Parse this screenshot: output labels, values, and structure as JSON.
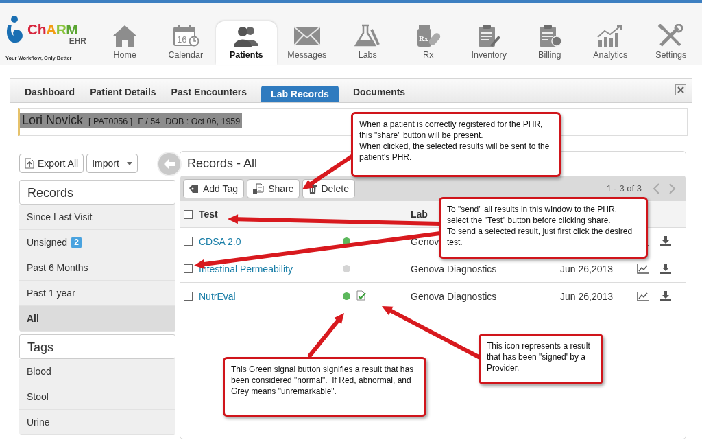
{
  "logo": {
    "name": "ChARM",
    "suffix": "EHR",
    "tagline": "Your Workflow, Only Better"
  },
  "nav": [
    {
      "label": "Home",
      "kind": "home",
      "selected": false
    },
    {
      "label": "Calendar",
      "kind": "calendar",
      "icon_text": "16",
      "selected": false
    },
    {
      "label": "Patients",
      "kind": "patients",
      "selected": true
    },
    {
      "label": "Messages",
      "kind": "messages",
      "selected": false
    },
    {
      "label": "Labs",
      "kind": "labs",
      "selected": false
    },
    {
      "label": "Rx",
      "kind": "rx",
      "icon_text": "Rx",
      "selected": false
    },
    {
      "label": "Inventory",
      "kind": "inventory",
      "selected": false
    },
    {
      "label": "Billing",
      "kind": "billing",
      "selected": false
    },
    {
      "label": "Analytics",
      "kind": "analytics",
      "selected": false
    },
    {
      "label": "Settings",
      "kind": "settings",
      "selected": false
    }
  ],
  "subtabs": [
    {
      "label": "Dashboard",
      "selected": false
    },
    {
      "label": "Patient Details",
      "selected": false
    },
    {
      "label": "Past Encounters",
      "selected": false
    },
    {
      "label": "Lab Records",
      "selected": true
    },
    {
      "label": "Documents",
      "selected": false
    }
  ],
  "patient": {
    "name": "Lori Novick",
    "id": "[ PAT0056 ]",
    "sex_age": "F / 54",
    "dob": "DOB : Oct 06, 1959"
  },
  "sidebar": {
    "buttons": [
      {
        "label": "Export All",
        "kind": "export"
      },
      {
        "label": "Import",
        "kind": "dropdown"
      }
    ],
    "sections": [
      {
        "title": "Records",
        "items": [
          {
            "label": "Since Last Visit",
            "selected": false
          },
          {
            "label": "Unsigned",
            "badge": "2",
            "selected": false
          },
          {
            "label": "Past 6 Months",
            "selected": false
          },
          {
            "label": "Past 1 year",
            "selected": false
          },
          {
            "label": "All",
            "selected": true
          }
        ]
      },
      {
        "title": "Tags",
        "items": [
          {
            "label": "Blood",
            "selected": false
          },
          {
            "label": "Stool",
            "selected": false
          },
          {
            "label": "Urine",
            "selected": false
          }
        ]
      }
    ]
  },
  "records": {
    "title": "Records - All",
    "toolbar": [
      {
        "label": "Add Tag",
        "kind": "tag"
      },
      {
        "label": "Share",
        "kind": "share"
      },
      {
        "label": "Delete",
        "kind": "trash"
      }
    ],
    "pager": "1 - 3 of 3",
    "select_all": {
      "checked": false
    },
    "columns": [
      "Test",
      "Lab"
    ],
    "rows": [
      {
        "test": "CDSA 2.0",
        "color": "#5cb85c",
        "signed": false,
        "lab": "Genov",
        "checked": false
      },
      {
        "test": "Intestinal Permeability",
        "color": "#d4d4d4",
        "signed": false,
        "lab": "Genova Diagnostics",
        "date": "Jun 26,2013",
        "checked": false
      },
      {
        "test": "NutrEval",
        "color": "#5cb85c",
        "signed": true,
        "lab": "Genova Diagnostics",
        "date": "Jun 26,2013",
        "checked": false
      }
    ]
  },
  "callouts": [
    {
      "text": "When a patient is correctly registered for the PHR, this \"share\" button will be present.\nWhen clicked, the selected results will be sent to the patient's PHR."
    },
    {
      "text": "To \"send\" all results in this window to the PHR, select the \"Test\" button before clicking share.\nTo send a selected result, just first click the desired test."
    },
    {
      "text": "This Green signal button signifies a result that has been considered \"normal\".  If Red, abnormal, and Grey means \"unremarkable\"."
    },
    {
      "text": "This icon represents a result that has been \"signed' by a Provider."
    }
  ]
}
